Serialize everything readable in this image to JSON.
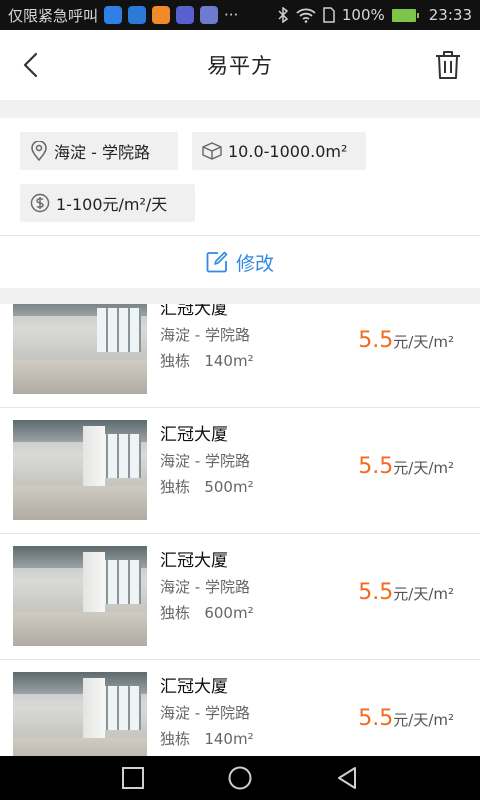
{
  "status_bar": {
    "carrier": "仅限紧急呼叫",
    "more": "···",
    "battery": "100%",
    "time": "23:33",
    "app_colors": [
      "#2f7fe6",
      "#2c7ad8",
      "#f08a2a",
      "#5a5fd0",
      "#6c7bd0"
    ]
  },
  "header": {
    "title": "易平方"
  },
  "filters": {
    "location": "海淀 - 学院路",
    "area": "10.0-1000.0m²",
    "price": "1-100元/m²/天",
    "edit_label": "修改"
  },
  "listings": [
    {
      "name": "汇冠大厦",
      "address": "海淀 - 学院路",
      "type": "独栋",
      "area": "140m²",
      "price": "5.5",
      "price_unit": "元/天/m²"
    },
    {
      "name": "汇冠大厦",
      "address": "海淀 - 学院路",
      "type": "独栋",
      "area": "500m²",
      "price": "5.5",
      "price_unit": "元/天/m²"
    },
    {
      "name": "汇冠大厦",
      "address": "海淀 - 学院路",
      "type": "独栋",
      "area": "600m²",
      "price": "5.5",
      "price_unit": "元/天/m²"
    },
    {
      "name": "汇冠大厦",
      "address": "海淀 - 学院路",
      "type": "独栋",
      "area": "140m²",
      "price": "5.5",
      "price_unit": "元/天/m²"
    }
  ],
  "colors": {
    "accent_blue": "#2f8ae5",
    "price_orange": "#f26c1f",
    "battery_green": "#7cc44a"
  }
}
